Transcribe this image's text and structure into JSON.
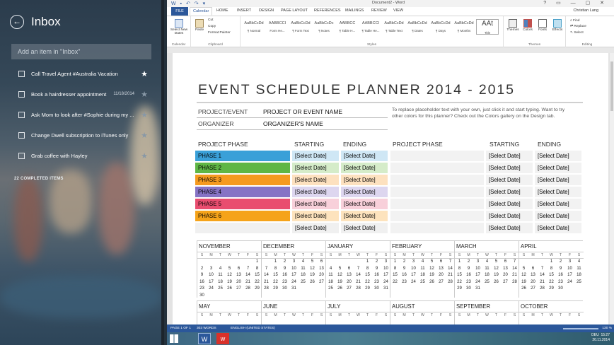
{
  "wunderlist": {
    "title": "Inbox",
    "add_placeholder": "Add an item in \"Inbox\"",
    "tasks": [
      {
        "text": "Call Travel Agent #Australia Vacation",
        "date": "",
        "starred": true
      },
      {
        "text": "Book a hairdresser appointment",
        "date": "11/18/2014",
        "starred": false
      },
      {
        "text": "Ask Mom to look after #Sophie during my ...",
        "date": "",
        "starred": false
      },
      {
        "text": "Change Dwell subscription to iTunes only",
        "date": "",
        "starred": false
      },
      {
        "text": "Grab coffee with Hayley",
        "date": "",
        "starred": false
      }
    ],
    "completed": "22 COMPLETED ITEMS"
  },
  "word": {
    "title": "Document2 - Word",
    "user": "Christian Lang",
    "tabs": [
      "FILE",
      "Calendar",
      "HOME",
      "INSERT",
      "DESIGN",
      "PAGE LAYOUT",
      "REFERENCES",
      "MAILINGS",
      "REVIEW",
      "VIEW"
    ],
    "ribbon": {
      "select_dates": "Select New Dates",
      "calendar_group": "Calendar",
      "paste": "Paste",
      "cut": "Cut",
      "copy": "Copy",
      "format_painter": "Format Painter",
      "clipboard_group": "Clipboard",
      "styles": [
        {
          "pv": "AaBbCcDd",
          "nm": "¶ Normal"
        },
        {
          "pv": "AABBCCI",
          "nm": "Form He..."
        },
        {
          "pv": "AaBbCcDd",
          "nm": "¶ Form Text"
        },
        {
          "pv": "AaBbCcDc",
          "nm": "¶ Notes"
        },
        {
          "pv": "AABBCC",
          "nm": "¶ Table H..."
        },
        {
          "pv": "AABBCCI",
          "nm": "¶ Table He..."
        },
        {
          "pv": "AaBbCcDd",
          "nm": "¶ Table Text"
        },
        {
          "pv": "AaBbCcDd",
          "nm": "¶ Dates"
        },
        {
          "pv": "AaBbCcDd",
          "nm": "¶ Days"
        },
        {
          "pv": "AaBbCcDd",
          "nm": "¶ Months"
        },
        {
          "pv": "AAt",
          "nm": "Title"
        }
      ],
      "styles_group": "Styles",
      "themes": "Themes",
      "colors": "Colors",
      "fonts": "Fonts",
      "effects": "Effects",
      "themes_group": "Themes",
      "find": "Find",
      "replace": "Replace",
      "select": "Select",
      "editing_group": "Editing"
    },
    "doc": {
      "title": "EVENT SCHEDULE PLANNER 2014 - 2015",
      "project_label": "PROJECT/EVENT",
      "project_value": "PROJECT OR EVENT NAME",
      "organizer_label": "ORGANIZER",
      "organizer_value": "ORGANIZER'S NAME",
      "note": "To replace placeholder text with your own, just click it and start typing. Want to try other colors for this planner? Check out the Colors gallery on the Design tab.",
      "col_phase": "PROJECT PHASE",
      "col_start": "STARTING",
      "col_end": "ENDING",
      "phases": [
        "PHASE 1",
        "PHASE 2",
        "PHASE 3",
        "PHASE 4",
        "PHASE 5",
        "PHASE 6",
        ""
      ],
      "select_date": "[Select Date]",
      "phase_colors": [
        "#3aa0d8",
        "#5fb645",
        "#f59a1f",
        "#8673c5",
        "#e94d6f",
        "#f5a31a"
      ],
      "light_colors": [
        "#cfe7f5",
        "#d5ecc9",
        "#fde1bf",
        "#ddd6ef",
        "#f8d0da",
        "#fde3bd",
        "#f0f0f0"
      ],
      "months": [
        "NOVEMBER",
        "DECEMBER",
        "JANUARY",
        "FEBRUARY",
        "MARCH",
        "APRIL"
      ],
      "months2": [
        "MAY",
        "JUNE",
        "JULY",
        "AUGUST",
        "SEPTEMBER",
        "OCTOBER"
      ],
      "day_heads": [
        "S",
        "M",
        "T",
        "W",
        "T",
        "F",
        "S"
      ],
      "calendars": [
        [
          "",
          "",
          "",
          "",
          "",
          "",
          "1",
          "2",
          "3",
          "4",
          "5",
          "6",
          "7",
          "8",
          "9",
          "10",
          "11",
          "12",
          "13",
          "14",
          "15",
          "16",
          "17",
          "18",
          "19",
          "20",
          "21",
          "22",
          "23",
          "24",
          "25",
          "26",
          "27",
          "28",
          "29",
          "30"
        ],
        [
          "",
          "1",
          "2",
          "3",
          "4",
          "5",
          "6",
          "7",
          "8",
          "9",
          "10",
          "11",
          "12",
          "13",
          "14",
          "15",
          "16",
          "17",
          "18",
          "19",
          "20",
          "21",
          "22",
          "23",
          "24",
          "25",
          "26",
          "27",
          "28",
          "29",
          "30",
          "31"
        ],
        [
          "",
          "",
          "",
          "",
          "1",
          "2",
          "3",
          "4",
          "5",
          "6",
          "7",
          "8",
          "9",
          "10",
          "11",
          "12",
          "13",
          "14",
          "15",
          "16",
          "17",
          "18",
          "19",
          "20",
          "21",
          "22",
          "23",
          "24",
          "25",
          "26",
          "27",
          "28",
          "29",
          "30",
          "31"
        ],
        [
          "1",
          "2",
          "3",
          "4",
          "5",
          "6",
          "7",
          "8",
          "9",
          "10",
          "11",
          "12",
          "13",
          "14",
          "15",
          "16",
          "17",
          "18",
          "19",
          "20",
          "21",
          "22",
          "23",
          "24",
          "25",
          "26",
          "27",
          "28"
        ],
        [
          "1",
          "2",
          "3",
          "4",
          "5",
          "6",
          "7",
          "8",
          "9",
          "10",
          "11",
          "12",
          "13",
          "14",
          "15",
          "16",
          "17",
          "18",
          "19",
          "20",
          "21",
          "22",
          "23",
          "24",
          "25",
          "26",
          "27",
          "28",
          "29",
          "30",
          "31"
        ],
        [
          "",
          "",
          "",
          "1",
          "2",
          "3",
          "4",
          "5",
          "6",
          "7",
          "8",
          "9",
          "10",
          "11",
          "12",
          "13",
          "14",
          "15",
          "16",
          "17",
          "18",
          "19",
          "20",
          "21",
          "22",
          "23",
          "24",
          "25",
          "26",
          "27",
          "28",
          "29",
          "30"
        ]
      ]
    },
    "status": {
      "page": "PAGE 1 OF 1",
      "words": "303 WORDS",
      "lang": "ENGLISH (UNITED STATES)",
      "zoom": "130 %"
    }
  },
  "taskbar": {
    "time": "15:27",
    "date": "20.11.2014",
    "lang": "DEU"
  }
}
